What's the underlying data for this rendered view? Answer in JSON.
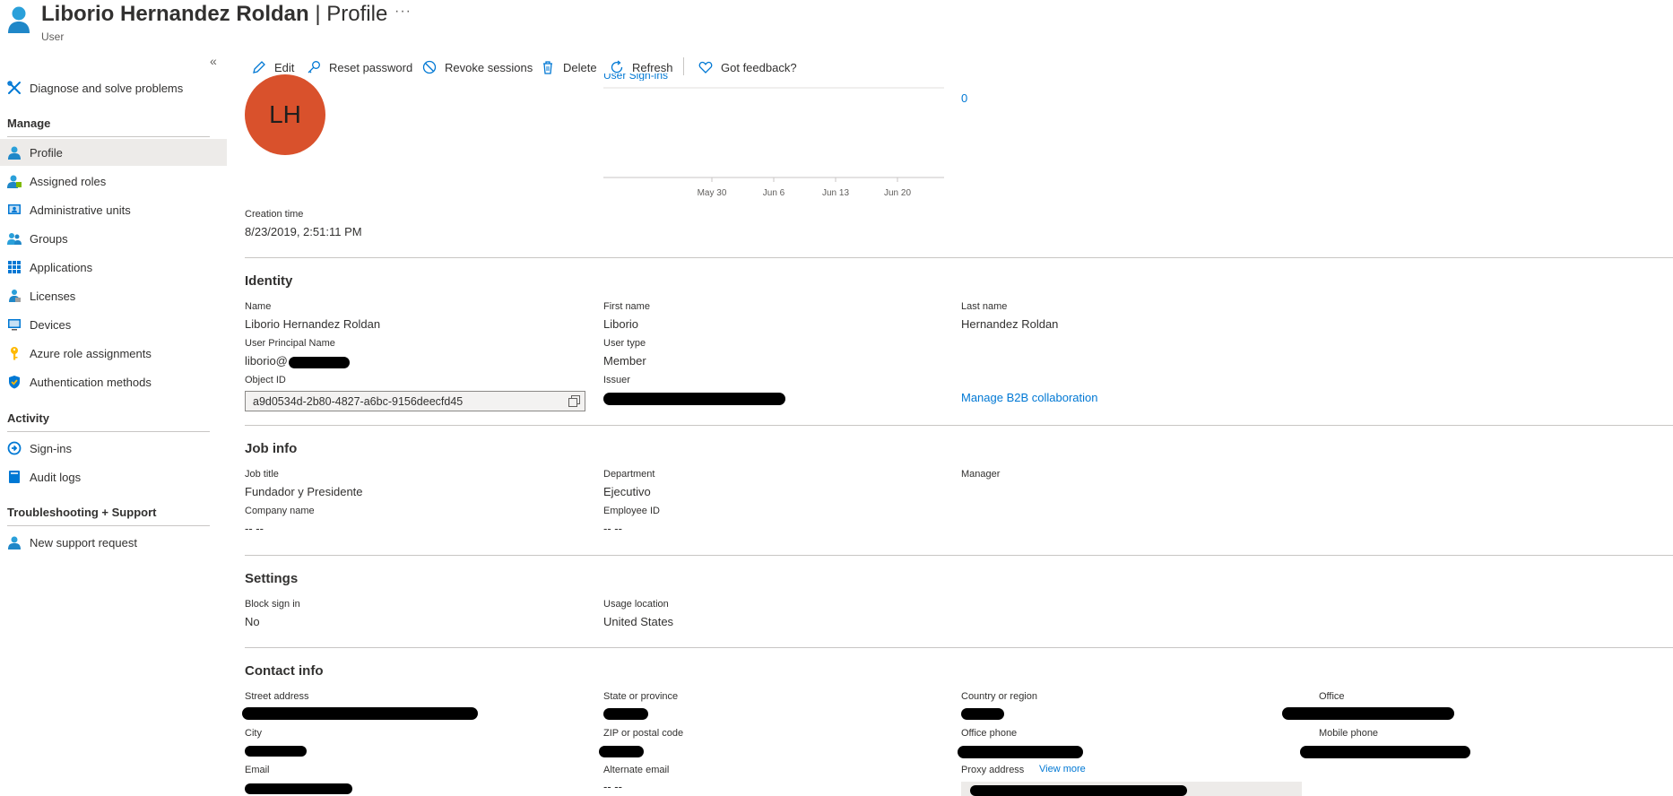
{
  "header": {
    "name": "Liborio Hernandez Roldan",
    "separator": "|",
    "page": "Profile",
    "more": "···",
    "subtitle": "User"
  },
  "sidebar": {
    "collapse_glyph": "«",
    "top_item": {
      "label": "Diagnose and solve problems",
      "icon": "wrench-icon"
    },
    "sections": [
      {
        "title": "Manage",
        "items": [
          {
            "label": "Profile",
            "icon": "user-icon",
            "selected": true
          },
          {
            "label": "Assigned roles",
            "icon": "user-roles-icon"
          },
          {
            "label": "Administrative units",
            "icon": "admin-units-icon"
          },
          {
            "label": "Groups",
            "icon": "groups-icon"
          },
          {
            "label": "Applications",
            "icon": "apps-grid-icon"
          },
          {
            "label": "Licenses",
            "icon": "license-icon"
          },
          {
            "label": "Devices",
            "icon": "device-icon"
          },
          {
            "label": "Azure role assignments",
            "icon": "key-icon"
          },
          {
            "label": "Authentication methods",
            "icon": "shield-icon"
          }
        ]
      },
      {
        "title": "Activity",
        "items": [
          {
            "label": "Sign-ins",
            "icon": "signin-icon"
          },
          {
            "label": "Audit logs",
            "icon": "book-icon"
          }
        ]
      },
      {
        "title": "Troubleshooting + Support",
        "items": [
          {
            "label": "New support request",
            "icon": "support-icon"
          }
        ]
      }
    ]
  },
  "toolbar": {
    "edit": "Edit",
    "reset_password": "Reset password",
    "revoke_sessions": "Revoke sessions",
    "delete": "Delete",
    "refresh": "Refresh",
    "feedback": "Got feedback?"
  },
  "overview": {
    "avatar_initials": "LH",
    "chart_link": "User Sign-ins",
    "stat_value": "0",
    "creation_label": "Creation time",
    "creation_value": "8/23/2019, 2:51:11 PM"
  },
  "chart_data": {
    "type": "line",
    "title": "User Sign-ins",
    "x_ticks": [
      "May 30",
      "Jun 6",
      "Jun 13",
      "Jun 20"
    ],
    "series": []
  },
  "identity": {
    "title": "Identity",
    "name_label": "Name",
    "name_value": "Liborio Hernandez Roldan",
    "first_label": "First name",
    "first_value": "Liborio",
    "last_label": "Last name",
    "last_value": "Hernandez Roldan",
    "upn_label": "User Principal Name",
    "upn_value": "liborio@",
    "type_label": "User type",
    "type_value": "Member",
    "oid_label": "Object ID",
    "oid_value": "a9d0534d-2b80-4827-a6bc-9156deecfd45",
    "issuer_label": "Issuer",
    "b2b_link": "Manage B2B collaboration"
  },
  "job": {
    "title": "Job info",
    "job_title_label": "Job title",
    "job_title_value": "Fundador y Presidente",
    "dept_label": "Department",
    "dept_value": "Ejecutivo",
    "manager_label": "Manager",
    "company_label": "Company name",
    "company_value": "-- --",
    "empid_label": "Employee ID",
    "empid_value": "-- --"
  },
  "settings": {
    "title": "Settings",
    "block_label": "Block sign in",
    "block_value": "No",
    "usage_label": "Usage location",
    "usage_value": "United States"
  },
  "contact": {
    "title": "Contact info",
    "street_label": "Street address",
    "state_label": "State or province",
    "country_label": "Country or region",
    "office_label": "Office",
    "city_label": "City",
    "zip_label": "ZIP or postal code",
    "ophone_label": "Office phone",
    "mphone_label": "Mobile phone",
    "email_label": "Email",
    "alt_email_label": "Alternate email",
    "alt_email_value": "-- --",
    "proxy_label": "Proxy address",
    "view_more": "View more"
  },
  "colors": {
    "accent": "#0078d4",
    "avatar": "#d9512c",
    "selected_bg": "#edebe9"
  }
}
